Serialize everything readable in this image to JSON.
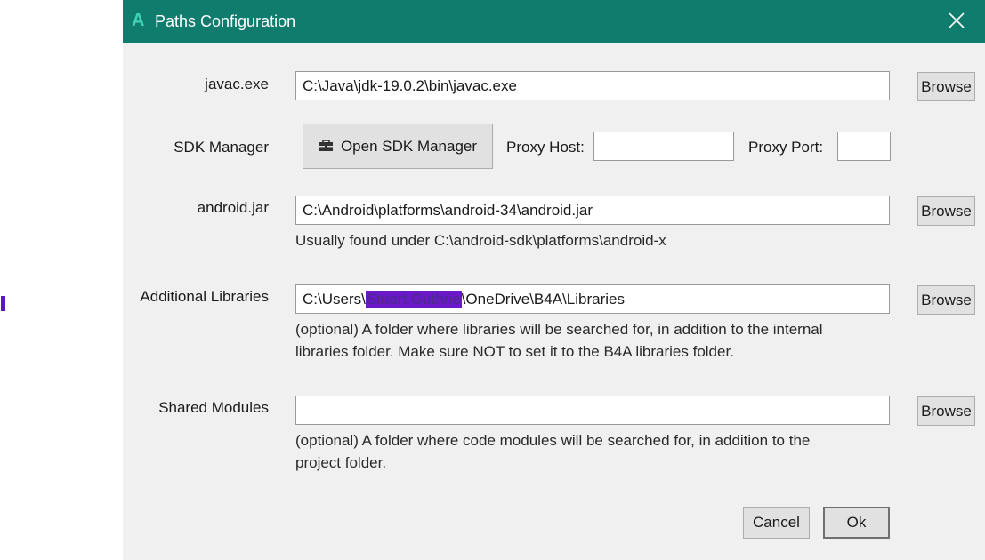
{
  "window": {
    "title": "Paths Configuration",
    "app_icon": "A"
  },
  "javac": {
    "label": "javac.exe",
    "value": "C:\\Java\\jdk-19.0.2\\bin\\javac.exe",
    "browse": "Browse"
  },
  "sdk": {
    "label": "SDK Manager",
    "button": "Open SDK Manager",
    "proxy_host_label": "Proxy Host:",
    "proxy_host_value": "",
    "proxy_port_label": "Proxy Port:",
    "proxy_port_value": ""
  },
  "android_jar": {
    "label": "android.jar",
    "value": "C:\\Android\\platforms\\android-34\\android.jar",
    "browse": "Browse",
    "hint": "Usually found under C:\\android-sdk\\platforms\\android-x"
  },
  "additional_libraries": {
    "label": "Additional Libraries",
    "value_prefix": "C:\\Users\\",
    "value_redacted": "Stuart Guthrie",
    "value_suffix": "\\OneDrive\\B4A\\Libraries",
    "browse": "Browse",
    "hint_line1": "(optional) A folder where libraries will be searched for, in addition to the internal",
    "hint_line2": "libraries folder. Make sure NOT to set it to the B4A libraries folder."
  },
  "shared_modules": {
    "label": "Shared Modules",
    "value": "",
    "browse": "Browse",
    "hint_line1": "(optional) A folder where code modules will be searched for, in addition to the",
    "hint_line2": "project folder."
  },
  "footer": {
    "cancel": "Cancel",
    "ok": "Ok"
  },
  "colors": {
    "titlebar": "#0f7c6e",
    "redaction": "#6a18c8",
    "dialog_bg": "#f0f0f0"
  },
  "icons": {
    "close": "close-icon",
    "sdk": "toolbox-icon"
  }
}
